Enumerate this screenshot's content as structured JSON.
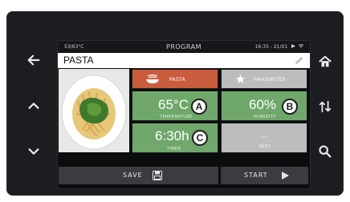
{
  "status_bar": {
    "temps": "53/63°C",
    "title": "PROGRAM",
    "time_date": "16:35 - 21/01"
  },
  "program": {
    "name": "PASTA"
  },
  "category_tile": {
    "label": "PASTA"
  },
  "favourites_tile": {
    "label": "FAVOURITES"
  },
  "temperature": {
    "value": "65°C",
    "label": "TEMPERATURE",
    "badge": "A"
  },
  "humidity": {
    "value": "60%",
    "label": "HUMIDITY",
    "badge": "B"
  },
  "timer": {
    "value": "6:30h",
    "label": "TIMER",
    "badge": "C"
  },
  "rest": {
    "value": "--",
    "label": "REST"
  },
  "actions": {
    "save_label": "SAVE",
    "start_label": "START"
  },
  "icons": {
    "left": [
      "arrow-left-icon",
      "chevron-up-icon",
      "chevron-down-icon"
    ],
    "right": [
      "home-icon",
      "swap-vertical-icon",
      "search-icon"
    ]
  },
  "colors": {
    "pasta_tile": "#c95c3c",
    "param_tile": "#6fa86a",
    "grey_tile": "#bdbdbd",
    "bezel": "#1b1d20"
  }
}
